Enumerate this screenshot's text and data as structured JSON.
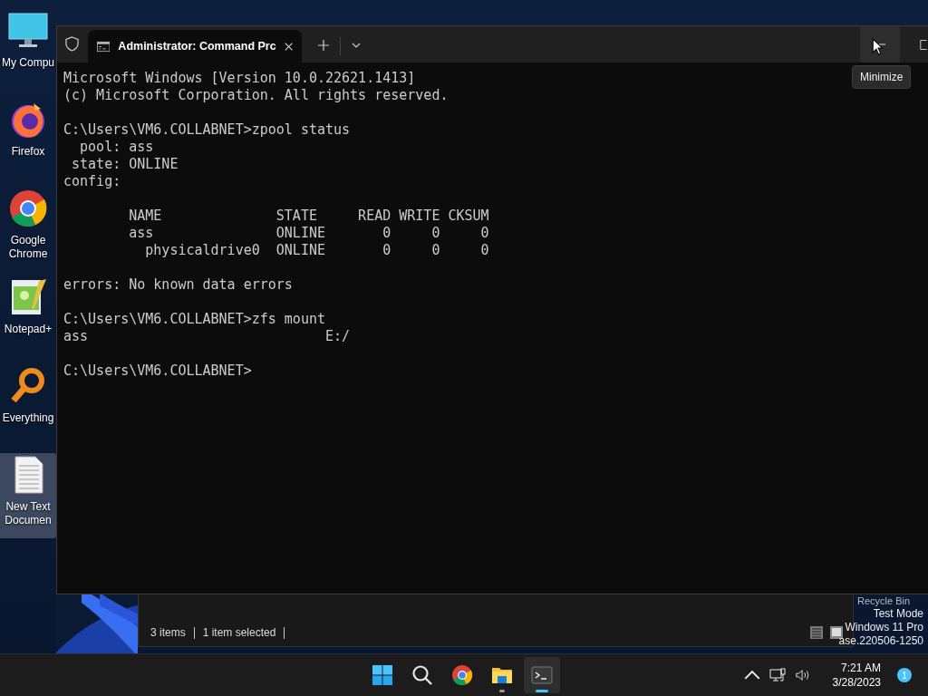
{
  "desktop_icons": [
    {
      "label": "My Compu",
      "kind": "computer",
      "selected": false
    },
    {
      "label": "Firefox",
      "kind": "firefox",
      "selected": false
    },
    {
      "label": "Google Chrome",
      "kind": "chrome",
      "selected": false
    },
    {
      "label": "Notepad+",
      "kind": "notepad",
      "selected": false
    },
    {
      "label": "Everything",
      "kind": "everything",
      "selected": false
    },
    {
      "label": "New Text Documen",
      "kind": "textfile",
      "selected": true
    }
  ],
  "terminal": {
    "tabs": [
      {
        "title": "Administrator:  Command Prc",
        "selected": true
      }
    ],
    "blocks": [
      [
        "Microsoft Windows [Version 10.0.22621.1413]",
        "(c) Microsoft Corporation. All rights reserved."
      ],
      [
        "C:\\Users\\VM6.COLLABNET>zpool status",
        "  pool: ass",
        " state: ONLINE",
        "config:"
      ],
      [
        "        NAME              STATE     READ WRITE CKSUM",
        "        ass               ONLINE       0     0     0",
        "          physicaldrive0  ONLINE       0     0     0"
      ],
      [
        "errors: No known data errors"
      ],
      [
        "C:\\Users\\VM6.COLLABNET>zfs mount",
        "ass                             E:/"
      ],
      [
        "C:\\Users\\VM6.COLLABNET>"
      ]
    ],
    "tooltip": "Minimize"
  },
  "explorer": {
    "status": [
      "3 items",
      "1 item selected"
    ],
    "desktop_label": "Recycle Bin"
  },
  "system_info": [
    "Test Mode",
    "Windows 11 Pro",
    "ase.220506-1250"
  ],
  "taskbar": {
    "apps": [
      {
        "kind": "start",
        "running": false,
        "active": false
      },
      {
        "kind": "search",
        "running": false,
        "active": false
      },
      {
        "kind": "chrome",
        "running": false,
        "active": false
      },
      {
        "kind": "explorer",
        "running": true,
        "active": false
      },
      {
        "kind": "terminal",
        "running": true,
        "active": true
      }
    ],
    "time": "7:21 AM",
    "date": "3/28/2023",
    "notifications": "1"
  }
}
